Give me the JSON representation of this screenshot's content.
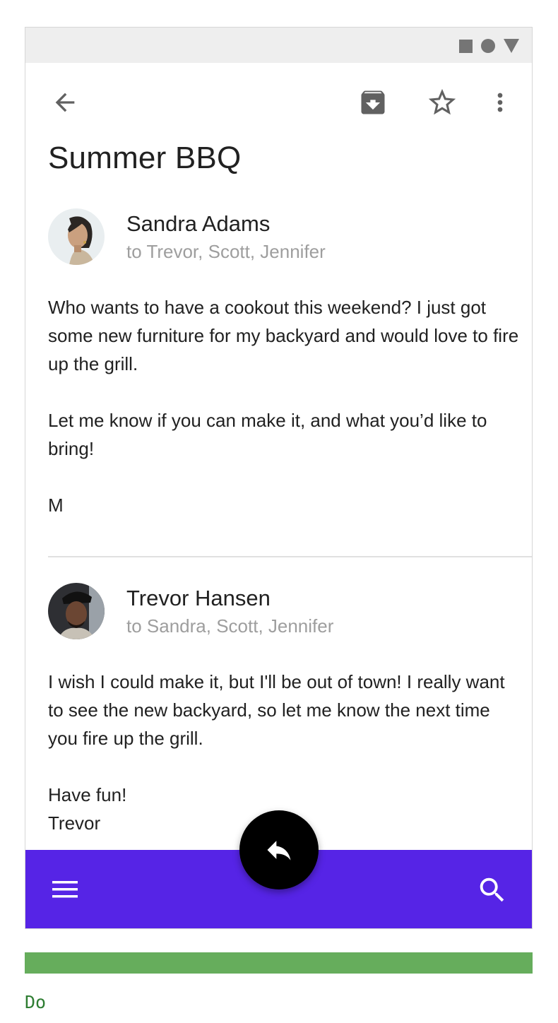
{
  "status_bar": {
    "icons": [
      "square-icon",
      "circle-icon",
      "triangle-icon"
    ]
  },
  "toolbar": {
    "icons": [
      "back-arrow-icon",
      "archive-icon",
      "star-icon",
      "more-vert-icon"
    ]
  },
  "email": {
    "subject": "Summer BBQ",
    "messages": [
      {
        "sender": "Sandra Adams",
        "recipients": "to Trevor, Scott, Jennifer",
        "body": "Who wants to have a cookout this weekend? I just got some new furniture for my backyard and would love to fire up the grill.\n\nLet me know if you can make it, and what you’d like to bring!\n\nM"
      },
      {
        "sender": "Trevor Hansen",
        "recipients": "to Sandra, Scott, Jennifer",
        "body": "I wish I could make it, but I'll be out of town! I really want to see the new backyard, so let me know the next time you fire up the grill.\n\nHave fun!\nTrevor"
      }
    ]
  },
  "bottom_app_bar": {
    "icons": [
      "menu-icon",
      "search-icon"
    ],
    "fab_icon": "reply-icon"
  },
  "colors": {
    "bottom_bar": "#5624e6",
    "fab": "#000000",
    "do_bar": "#66ad5c",
    "do_label": "#2e7d32"
  },
  "guideline": {
    "label": "Do"
  }
}
